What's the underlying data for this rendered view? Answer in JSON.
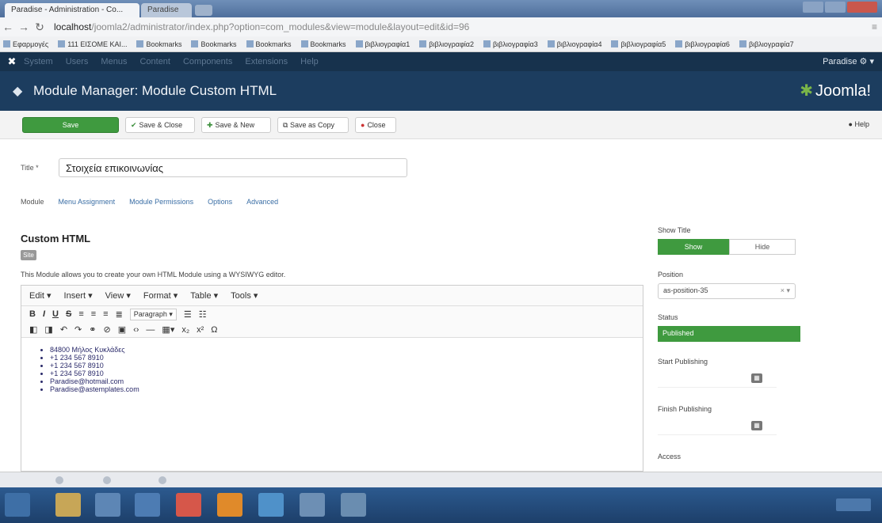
{
  "browser": {
    "tab_active": "Paradise - Administration - Co...",
    "tab_inactive": "Paradise",
    "url_host": "localhost",
    "url_path": "/joomla2/administrator/index.php?option=com_modules&view=module&layout=edit&id=96",
    "bookmarks": [
      "Εφαρμογές",
      "111 ΕΙΣΟΜΕ ΚΑΙ...",
      "Bookmarks",
      "Bookmarks",
      "Bookmarks",
      "Bookmarks",
      "βιβλιογραφία1",
      "βιβλιογραφία2",
      "βιβλιογραφία3",
      "βιβλιογραφία4",
      "βιβλιογραφία5",
      "βιβλιογραφία6",
      "βιβλιογραφία7"
    ]
  },
  "topnav": {
    "user": "Paradise",
    "items": [
      "System",
      "Users",
      "Menus",
      "Content",
      "Components",
      "Extensions",
      "Help"
    ]
  },
  "header": {
    "title": "Module Manager: Module Custom HTML",
    "logo": "Joomla!"
  },
  "toolbar": {
    "save": "Save",
    "save_close": "Save & Close",
    "save_new": "Save & New",
    "save_copy": "Save as Copy",
    "close": "Close",
    "help": "Help"
  },
  "form": {
    "title_label": "Title *",
    "title_value": "Στοιχεία επικοινωνίας",
    "tabs": [
      "Module",
      "Menu Assignment",
      "Module Permissions",
      "Options",
      "Advanced"
    ],
    "section_title": "Custom HTML",
    "badge": "Site",
    "description": "This Module allows you to create your own HTML Module using a WYSIWYG editor."
  },
  "editor": {
    "menus": [
      "Edit ▾",
      "Insert ▾",
      "View ▾",
      "Format ▾",
      "Table ▾",
      "Tools ▾"
    ],
    "format_select": "Paragraph",
    "items": [
      "84800 Μήλος Κυκλάδες",
      "+1 234 567 8910",
      "+1 234 567 8910",
      "+1 234 567 8910",
      "Paradise@hotmail.com",
      "Paradise@astemplates.com"
    ]
  },
  "sidebar": {
    "show_title_label": "Show Title",
    "show": "Show",
    "hide": "Hide",
    "position_label": "Position",
    "position_value": "as-position-35",
    "status_label": "Status",
    "status_value": "Published",
    "start_label": "Start Publishing",
    "finish_label": "Finish Publishing",
    "access_label": "Access"
  },
  "colors": {
    "nav": "#17324d",
    "header": "#1c3d5f",
    "success": "#3f9a3f"
  }
}
